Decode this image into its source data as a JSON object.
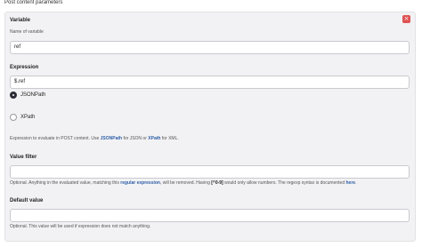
{
  "section_title": "Post content parameters",
  "close_label": "×",
  "variable": {
    "label": "Variable",
    "help": "Name of variable",
    "value": "ref"
  },
  "expression": {
    "label": "Expression",
    "value": "$.ref",
    "options": [
      "JSONPath",
      "XPath"
    ],
    "selected": "JSONPath",
    "help_prefix": "Expression to evaluate in POST content. Use ",
    "help_link1": "JSONPath",
    "help_mid": " for JSON or ",
    "help_link2": "XPath",
    "help_suffix": " for XML."
  },
  "value_filter": {
    "label": "Value filter",
    "value": "",
    "help_prefix": "Optional. Anything in the evaluated value, matching this ",
    "help_link": "regular expression",
    "help_mid": ", will be removed. Having ",
    "help_code": "[^0-9]",
    "help_mid2": " would only allow numbers. The regexp syntax is documented ",
    "help_link2": "here",
    "help_suffix": "."
  },
  "default_value": {
    "label": "Default value",
    "value": "",
    "help": "Optional. This value will be used if expression does not match anything."
  }
}
